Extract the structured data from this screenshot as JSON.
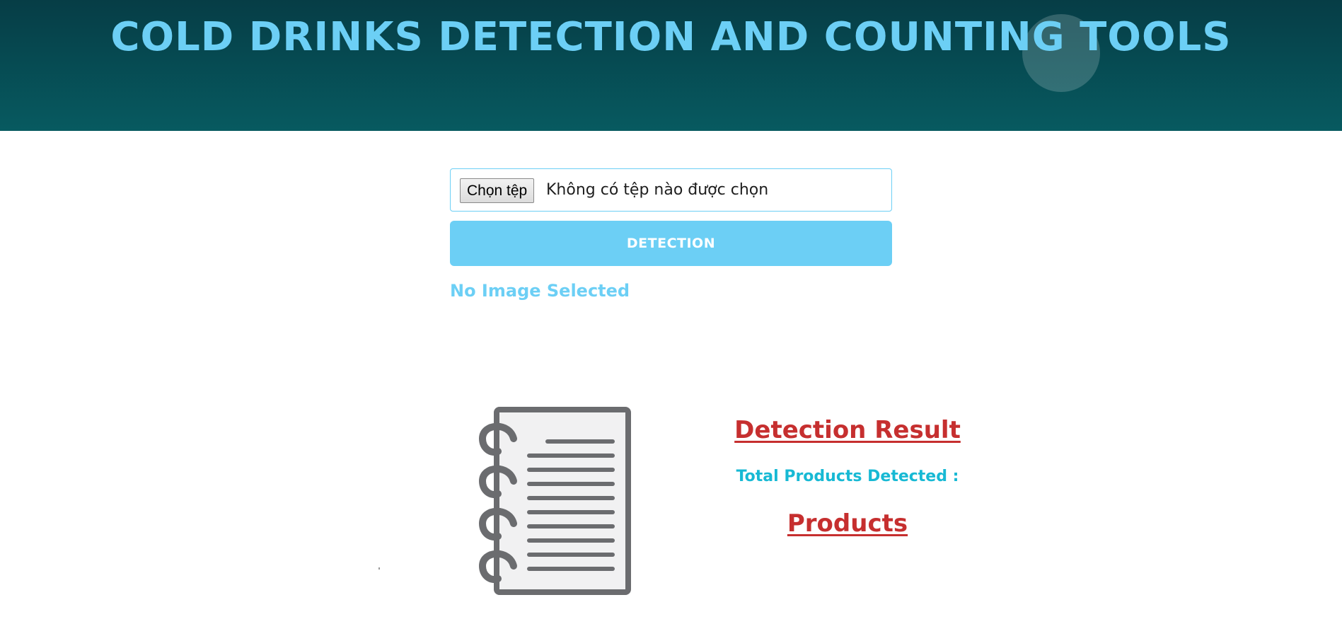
{
  "header": {
    "title": "COLD DRINKS DETECTION AND COUNTING TOOLS"
  },
  "upload": {
    "choose_button_label": "Chọn tệp",
    "file_status": "Không có tệp nào được chọn",
    "detect_button_label": "DETECTION",
    "preview_status": "No Image Selected"
  },
  "result": {
    "title": "Detection Result",
    "total_label": "Total Products Detected :",
    "products_label": "Products"
  },
  "icons": {
    "notebook": "spiral-notebook-icon"
  },
  "colors": {
    "header_bg": "#075a60",
    "accent": "#6ccff5",
    "result_red": "#c62f2f",
    "total_cyan": "#17b9d4"
  }
}
